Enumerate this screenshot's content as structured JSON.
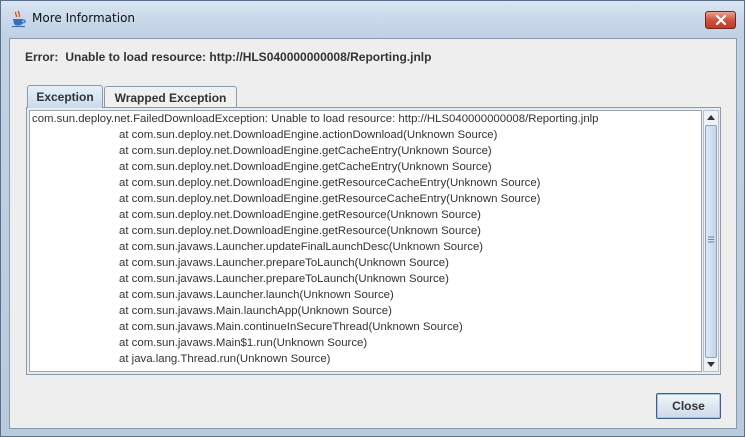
{
  "window": {
    "title": "More Information",
    "icon": "java-coffee-cup-icon",
    "close_icon": "close-icon"
  },
  "error": {
    "prefix": "Error:",
    "message": "Unable to load resource: http://HLS040000000008/Reporting.jnlp"
  },
  "tabs": [
    {
      "label": "Exception",
      "selected": true
    },
    {
      "label": "Wrapped Exception",
      "selected": false
    }
  ],
  "stack_trace": {
    "header": "com.sun.deploy.net.FailedDownloadException: Unable to load resource: http://HLS040000000008/Reporting.jnlp",
    "frames": [
      "at com.sun.deploy.net.DownloadEngine.actionDownload(Unknown Source)",
      "at com.sun.deploy.net.DownloadEngine.getCacheEntry(Unknown Source)",
      "at com.sun.deploy.net.DownloadEngine.getCacheEntry(Unknown Source)",
      "at com.sun.deploy.net.DownloadEngine.getResourceCacheEntry(Unknown Source)",
      "at com.sun.deploy.net.DownloadEngine.getResourceCacheEntry(Unknown Source)",
      "at com.sun.deploy.net.DownloadEngine.getResource(Unknown Source)",
      "at com.sun.deploy.net.DownloadEngine.getResource(Unknown Source)",
      "at com.sun.javaws.Launcher.updateFinalLaunchDesc(Unknown Source)",
      "at com.sun.javaws.Launcher.prepareToLaunch(Unknown Source)",
      "at com.sun.javaws.Launcher.prepareToLaunch(Unknown Source)",
      "at com.sun.javaws.Launcher.launch(Unknown Source)",
      "at com.sun.javaws.Main.launchApp(Unknown Source)",
      "at com.sun.javaws.Main.continueInSecureThread(Unknown Source)",
      "at com.sun.javaws.Main$1.run(Unknown Source)",
      "at java.lang.Thread.run(Unknown Source)"
    ]
  },
  "buttons": {
    "close_label": "Close"
  },
  "colors": {
    "window_frame": "#c3d3e6",
    "client_background": "#eeeeee",
    "close_button_red": "#c23a24",
    "text": "#333333"
  }
}
